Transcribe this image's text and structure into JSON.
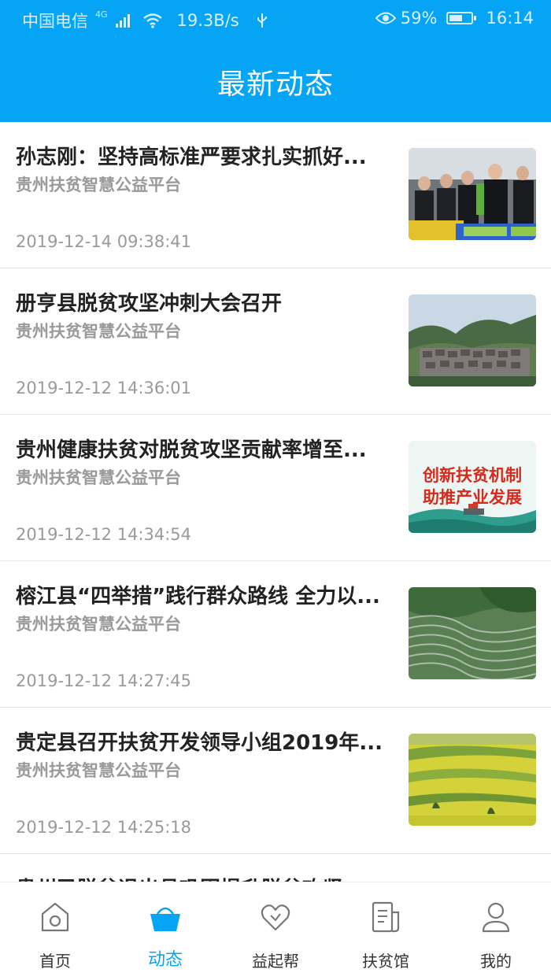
{
  "status_bar": {
    "carrier": "中国电信",
    "network": "4G",
    "speed": "19.3B/s",
    "battery": "59%",
    "battery_level": 0.59,
    "time": "16:14"
  },
  "header": {
    "title": "最新动态"
  },
  "articles": [
    {
      "title": "孙志刚：坚持高标准严要求扎实抓好...",
      "source": "贵州扶贫智慧公益平台",
      "time": "2019-12-14 09:38:41"
    },
    {
      "title": "册亨县脱贫攻坚冲刺大会召开",
      "source": "贵州扶贫智慧公益平台",
      "time": "2019-12-12 14:36:01"
    },
    {
      "title": "贵州健康扶贫对脱贫攻坚贡献率增至...",
      "source": "贵州扶贫智慧公益平台",
      "time": "2019-12-12 14:34:54",
      "thumb_text_1": "创新扶贫机制",
      "thumb_text_2": "助推产业发展"
    },
    {
      "title": "榕江县“四举措”践行群众路线 全力以...",
      "source": "贵州扶贫智慧公益平台",
      "time": "2019-12-12 14:27:45"
    },
    {
      "title": "贵定县召开扶贫开发领导小组2019年...",
      "source": "贵州扶贫智慧公益平台",
      "time": "2019-12-12 14:25:18"
    },
    {
      "title": "贵州已脱贫退出县巩固提升脱贫攻坚",
      "source": "",
      "time": ""
    }
  ],
  "tabs": [
    {
      "label": "首页",
      "icon": "home-icon"
    },
    {
      "label": "动态",
      "icon": "basket-icon"
    },
    {
      "label": "益起帮",
      "icon": "heart-icon"
    },
    {
      "label": "扶贫馆",
      "icon": "document-icon"
    },
    {
      "label": "我的",
      "icon": "user-icon"
    }
  ],
  "colors": {
    "accent": "#06a4f5",
    "text": "#222222",
    "muted": "#9a9a9a"
  }
}
